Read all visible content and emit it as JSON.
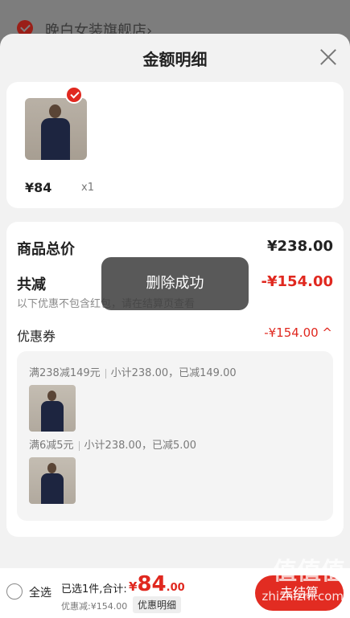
{
  "background": {
    "store_name": "晚白女装旗舰店",
    "store_chevron": "›"
  },
  "sheet": {
    "title": "金额明细"
  },
  "product": {
    "price": "¥84",
    "qty": "x1"
  },
  "totals": {
    "goods_total_label": "商品总价",
    "goods_total_value": "¥238.00",
    "reduction_label": "共减",
    "reduction_value": "-¥154.00",
    "note": "以下优惠不包含红包，请在结算页查看"
  },
  "coupon": {
    "label": "优惠券",
    "value": "-¥154.00 ^",
    "items": [
      {
        "rule": "满238减149元",
        "detail": "小计238.00，已减149.00"
      },
      {
        "rule": "满6减5元",
        "detail": "小计238.00，已减5.00"
      }
    ]
  },
  "toast": {
    "text": "删除成功"
  },
  "bottom": {
    "select_all": "全选",
    "summary": "已选1件,合计:",
    "total_yen": "¥",
    "total_int": "84",
    "total_dec": ".00",
    "discount": "优惠减:¥154.00",
    "detail_button": "优惠明细",
    "checkout": "去结算"
  },
  "watermark": {
    "main": "值值值",
    "sub": "zhizhizhi.com"
  },
  "colors": {
    "accent": "#e0281f",
    "sheet_bg": "#f2f2f2",
    "overlay": "#7f7f7f"
  }
}
